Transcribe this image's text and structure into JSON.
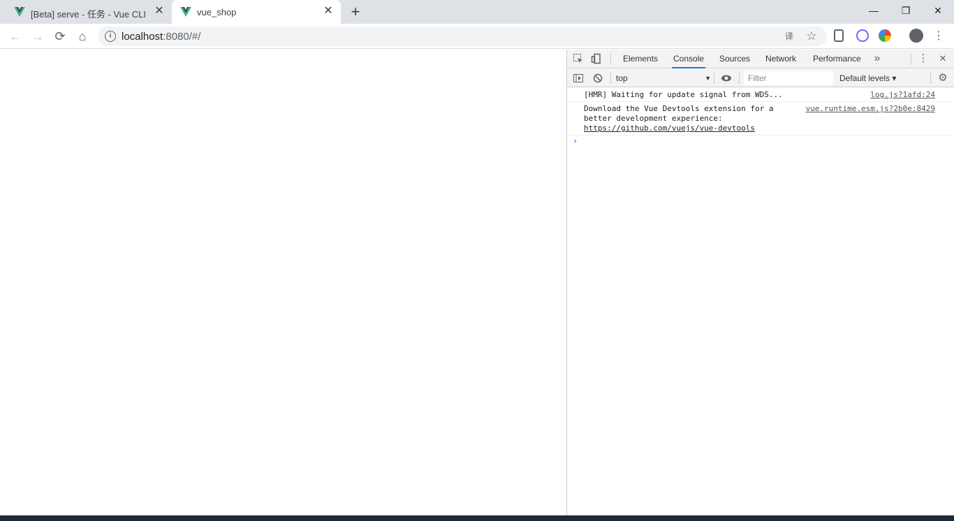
{
  "tabs": [
    {
      "title": "[Beta] serve - 任务 - Vue CLI",
      "favicon": "vue-icon"
    },
    {
      "title": "vue_shop",
      "favicon": "vue-icon"
    }
  ],
  "tab_close_glyph": "✕",
  "new_tab_glyph": "+",
  "window_controls": {
    "minimize": "—",
    "maximize": "❐",
    "close": "✕"
  },
  "nav": {
    "back": "←",
    "forward": "→",
    "reload": "⟳",
    "home": "⌂"
  },
  "address": {
    "info_glyph": "i",
    "host": "localhost",
    "rest": ":8080/#/"
  },
  "omnibox_icons": {
    "translate": "译",
    "star": "☆"
  },
  "devtools": {
    "tabs": [
      "Elements",
      "Console",
      "Sources",
      "Network",
      "Performance"
    ],
    "active_tab": "Console",
    "more_tabs_glyph": "»",
    "close_glyph": "✕",
    "menu_glyph": "⋮",
    "context": "top",
    "filter_placeholder": "Filter",
    "levels": "Default levels ▾",
    "messages": [
      {
        "text": "[HMR] Waiting for update signal from WDS...",
        "source": "log.js?1afd:24"
      },
      {
        "text": "Download the Vue Devtools extension for a better development experience:",
        "link": "https://github.com/vuejs/vue-devtools",
        "source": "vue.runtime.esm.js?2b0e:8429"
      }
    ],
    "prompt_glyph": "›"
  },
  "colors": {
    "accent": "#1a73e8",
    "vue_green": "#41b883",
    "vue_dark": "#35495e"
  }
}
